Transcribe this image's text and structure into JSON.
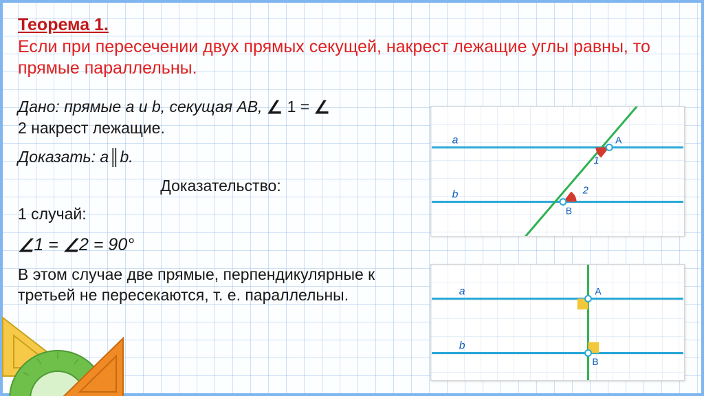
{
  "title": "Теорема 1.",
  "statement": "Если при пересечении двух прямых секущей, накрест лежащие углы равны, то прямые параллельны.",
  "given_line1": "Дано: прямые a и b, секущая AB, ",
  "given_eq_a": "∠",
  "given_eq_mid": " 1 = ",
  "given_eq_b": "∠",
  "given_line2": "2 накрест лежащие.",
  "prove": "Доказать: a║b.",
  "proof_heading": "Доказательство:",
  "case_label": "1 случай:",
  "case_eq_a": "∠",
  "case_eq_mid": "1 = ",
  "case_eq_b": "∠",
  "case_eq_end": "2 = 90°",
  "case_text": "В этом случае две прямые, перпендикулярные к третьей не пересекаются, т. е. параллельны.",
  "diagram1": {
    "a": "a",
    "b": "b",
    "A": "A",
    "B": "B",
    "ang1": "1",
    "ang2": "2"
  },
  "diagram2": {
    "a": "a",
    "b": "b",
    "A": "A",
    "B": "B"
  }
}
